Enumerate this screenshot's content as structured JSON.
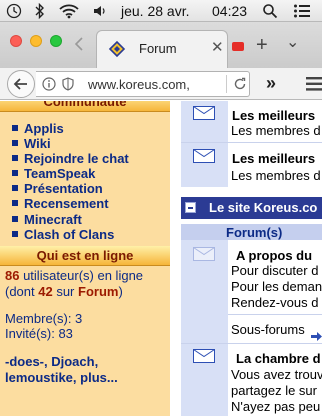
{
  "menubar": {
    "date": "jeu. 28 avr.",
    "time": "04:23"
  },
  "tab": {
    "title": "Forum",
    "close": "✕"
  },
  "toolbar": {
    "new_tab": "+",
    "chevron": "⌄",
    "overflow": "»"
  },
  "nav": {
    "url": "www.koreus.com,"
  },
  "sidebar": {
    "community_header": "Communauté",
    "links": [
      "Applis",
      "Wiki",
      "Rejoindre le chat",
      "TeamSpeak",
      "Présentation",
      "Recensement",
      "Minecraft",
      "Clash of Clans"
    ],
    "online_header": "Qui est en ligne",
    "online_count": "86",
    "online_text": " utilisateur(s) en ligne",
    "online_detail_pre": "(dont ",
    "online_forum_count": "42",
    "online_detail_mid": " sur ",
    "online_forum": "Forum",
    "online_detail_post": ")",
    "members": "Membre(s): 3",
    "guests": "Invité(s): 83",
    "users_line1": "-does-, Djoach,",
    "users_line2": "lemoustike, plus..."
  },
  "forum": {
    "row1_title": "Les meilleurs",
    "row1_desc": "Les membres d",
    "row2_title": "Les meilleurs",
    "row2_desc": "Les membres d",
    "section_title": "Le site Koreus.co",
    "col_header": "Forum(s)",
    "topic1_title": "A propos du",
    "topic1_line1": "Pour discuter d",
    "topic1_line2": "Pour les deman",
    "topic1_line3": "Rendez-vous d",
    "subforums": "Sous-forums",
    "topic2_title": "La chambre d",
    "topic2_line1": "Vous avez trouv",
    "topic2_line2": "partagez le sur",
    "topic2_line3": "N'ayez pas peu"
  },
  "colors": {
    "sidebar_bg": "#fcdda0",
    "link": "#0c2a86",
    "accent_red": "#9c1a00",
    "section_bar": "#2b3b94",
    "forum_icon_col": "#d8e0f6"
  }
}
